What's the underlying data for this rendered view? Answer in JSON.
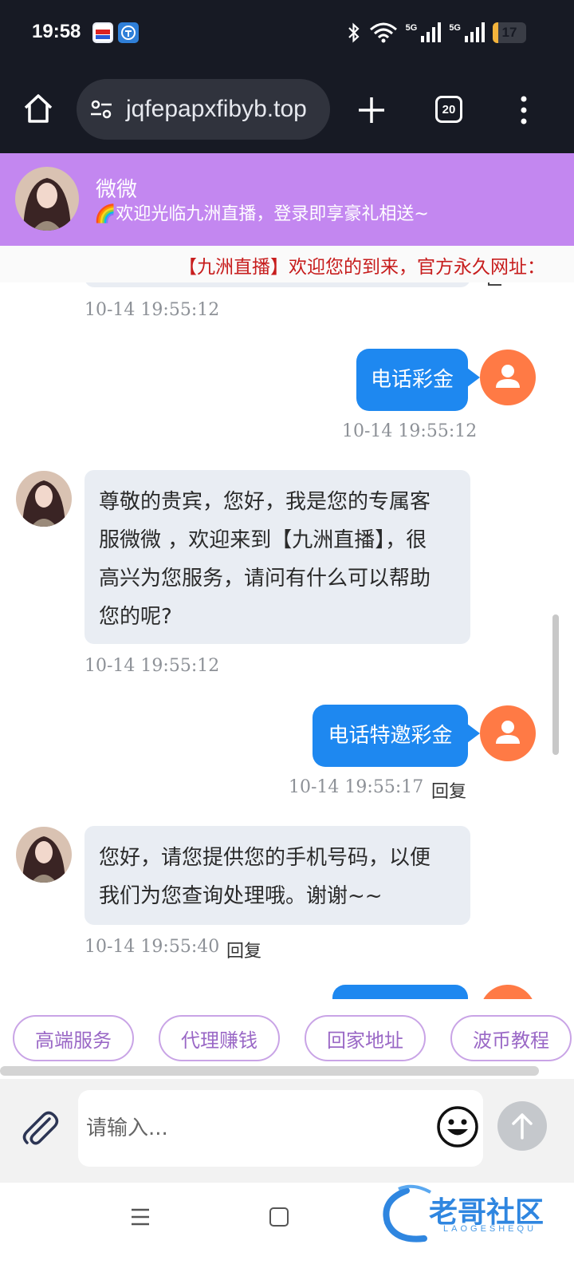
{
  "status_bar": {
    "time": "19:58",
    "net1": "5G",
    "net2": "5G",
    "battery": "17",
    "battery_level": 0.17
  },
  "browser": {
    "url": "jqfepapxfibyb.top",
    "tab_count": "20"
  },
  "header": {
    "agent_name": "微微",
    "welcome": "🌈欢迎光临九洲直播，登录即享豪礼相送~"
  },
  "marquee": {
    "text": "【九洲直播】欢迎您的到来，官方永久网址："
  },
  "messages": [
    {
      "from": "agent",
      "time": "10-14 19:55:12"
    },
    {
      "from": "user",
      "text": "电话彩金",
      "time": "10-14 19:55:12"
    },
    {
      "from": "agent",
      "lines": [
        "尊敬的贵宾，您好，我是您的专属客",
        "服微微 ，欢迎来到【九洲直播】，很",
        "高兴为您服务，请问有什么可以帮助",
        "您的呢?"
      ],
      "time": "10-14 19:55:12"
    },
    {
      "from": "user",
      "text": "电话特邀彩金",
      "time": "10-14 19:55:17",
      "reply": "回复"
    },
    {
      "from": "agent",
      "lines": [
        "您好，请您提供您的手机号码，以便",
        "我们为您查询处理哦。谢谢~~"
      ],
      "time": "10-14 19:55:40",
      "reply": "回复"
    }
  ],
  "quick_replies": [
    "高端服务",
    "代理赚钱",
    "回家地址",
    "波币教程"
  ],
  "input": {
    "placeholder": "请输入..."
  },
  "watermark": {
    "text": "老哥社区",
    "sub": "LAOGESHEQU"
  },
  "colors": {
    "header_bg": "#c387f0",
    "user_bubble": "#1e88f0",
    "agent_bubble": "#e9edf3",
    "user_avatar": "#ff7a45",
    "marquee_text": "#c71d1d"
  }
}
